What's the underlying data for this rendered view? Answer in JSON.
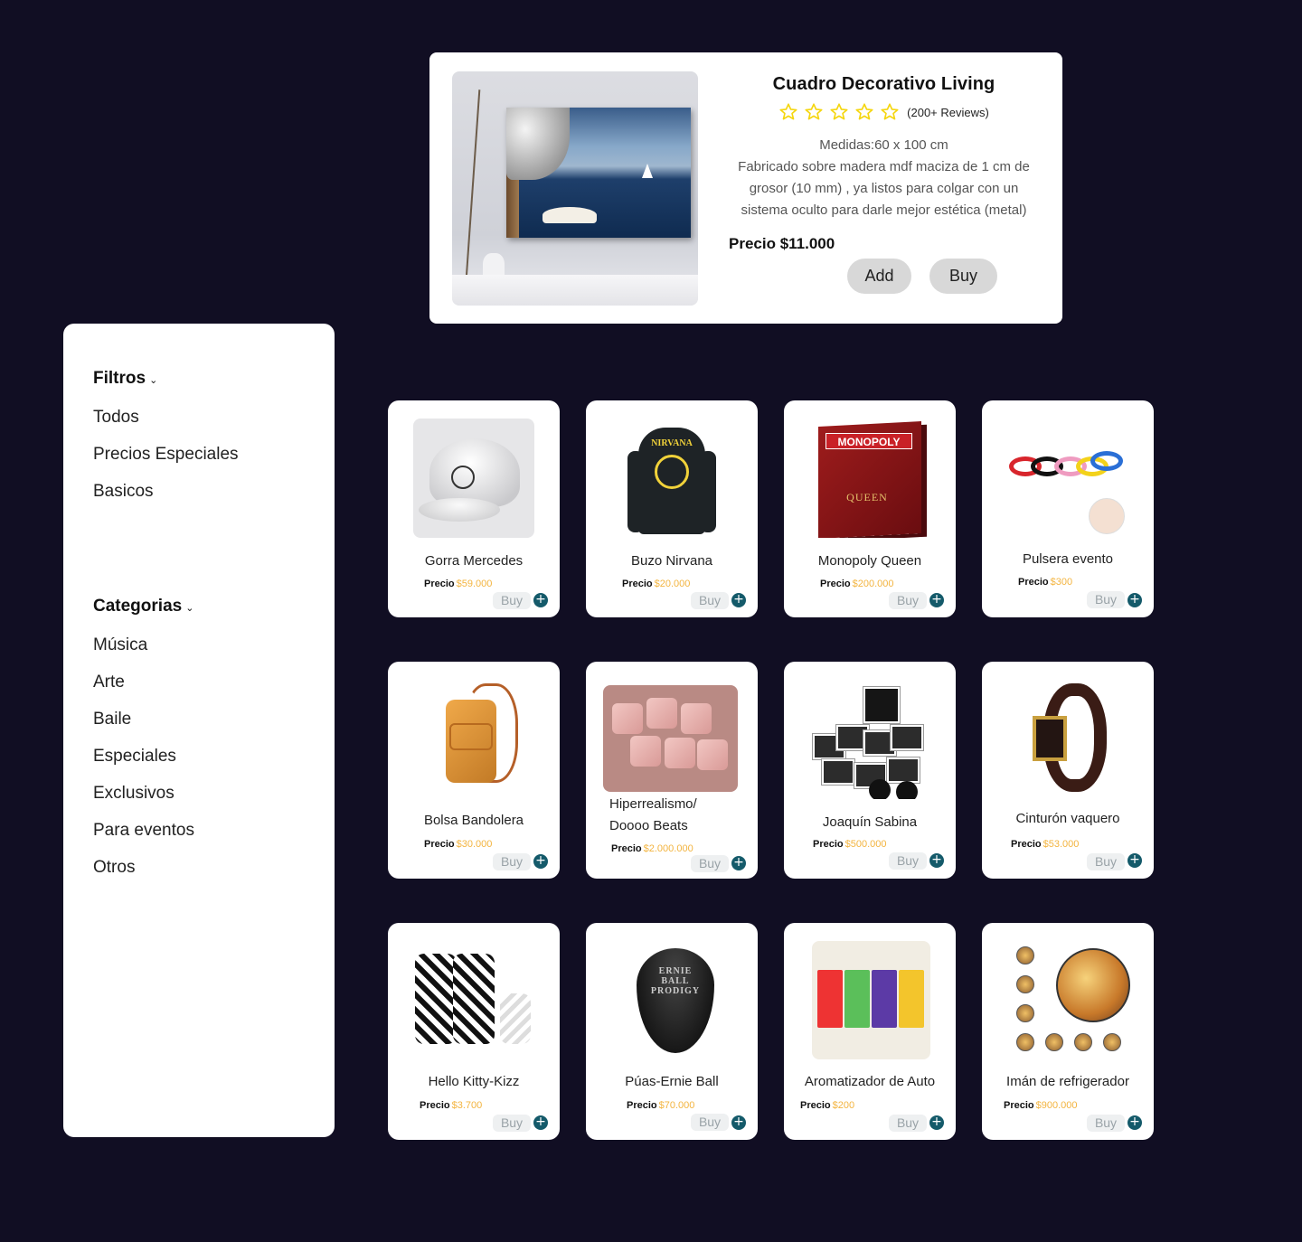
{
  "featured": {
    "title": "Cuadro Decorativo Living",
    "stars": 5,
    "reviews": "(200+ Reviews)",
    "measures": "Medidas:60 x 100 cm",
    "description": "Fabricado sobre madera mdf maciza de 1 cm de grosor (10 mm) , ya listos para colgar con un sistema oculto para darle mejor estética (metal)",
    "price": "Precio $11.000",
    "add_label": "Add",
    "buy_label": "Buy"
  },
  "sidebar": {
    "filters_title": "Filtros",
    "filters": [
      "Todos",
      "Precios Especiales",
      "Basicos"
    ],
    "categories_title": "Categorias",
    "categories": [
      "Música",
      "Arte",
      "Baile",
      "Especiales",
      "Exclusivos",
      "Para eventos",
      "Otros"
    ]
  },
  "products": [
    {
      "name": "Gorra Mercedes",
      "price_label": "Precio",
      "price": "$59.000",
      "buy": "Buy"
    },
    {
      "name": "Buzo Nirvana",
      "price_label": "Precio",
      "price": "$20.000",
      "buy": "Buy"
    },
    {
      "name": "Monopoly Queen",
      "price_label": "Precio",
      "price": "$200.000",
      "buy": "Buy"
    },
    {
      "name": "Pulsera evento",
      "price_label": "Precio",
      "price": "$300",
      "buy": "Buy"
    },
    {
      "name": "Bolsa Bandolera",
      "price_label": "Precio",
      "price": "$30.000",
      "buy": "Buy"
    },
    {
      "name": "Hiperrealismo/ Doooo Beats",
      "price_label": "Precio",
      "price": "$2.000.000",
      "buy": "Buy"
    },
    {
      "name": "Joaquín Sabina",
      "price_label": "Precio",
      "price": "$500.000",
      "buy": "Buy"
    },
    {
      "name": "Cinturón vaquero",
      "price_label": "Precio",
      "price": "$53.000",
      "buy": "Buy"
    },
    {
      "name": "Hello Kitty-Kizz",
      "price_label": "Precio",
      "price": "$3.700",
      "buy": "Buy"
    },
    {
      "name": "Púas-Ernie Ball",
      "price_label": "Precio",
      "price": "$70.000",
      "buy": "Buy"
    },
    {
      "name": "Aromatizador de Auto",
      "price_label": "Precio",
      "price": "$200",
      "buy": "Buy"
    },
    {
      "name": "Imán de refrigerador",
      "price_label": "Precio",
      "price": "$900.000",
      "buy": "Buy"
    }
  ],
  "thumb_text": {
    "nirvana": "NIRVANA",
    "monopoly": "MONOPOLY",
    "queen": "QUEEN",
    "pick": "ERNIE BALL PRODIGY"
  },
  "icons": {
    "plus": "+",
    "chevron": "⌄"
  },
  "colors": {
    "background": "#110e23",
    "price_amount": "#f3b43f",
    "plus_button": "#145a6a",
    "star": "#f5d60f"
  }
}
